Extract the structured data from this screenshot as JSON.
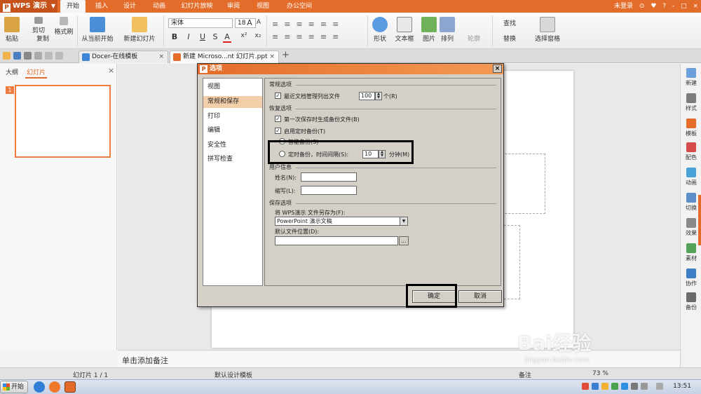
{
  "app": {
    "name": "WPS 演示",
    "logo_letter": "P",
    "menu_arrow": "▼",
    "tabs": [
      "开始",
      "插入",
      "设计",
      "动画",
      "幻灯片放映",
      "审阅",
      "视图",
      "办公空间"
    ],
    "login": "未登录",
    "title_icons": [
      "⊙",
      "♥",
      "?",
      "-",
      "□",
      "×"
    ]
  },
  "ribbon": {
    "paste": "粘贴",
    "cut": "剪切",
    "copy": "复制",
    "format_painter": "格式刷",
    "from_current": "从当前开始",
    "new_slide": "新建幻灯片",
    "font_name": "宋体",
    "font_size": "18",
    "grow_font": "A",
    "shrink_font": "A",
    "bold": "B",
    "italic": "I",
    "underline": "U",
    "strike": "S",
    "font_color": "A",
    "superscript": "x²",
    "subscript": "x₂",
    "shapes": "形状",
    "textbox": "文本框",
    "picture": "图片",
    "arrange": "排列",
    "outline": "轮廓",
    "find": "查找",
    "replace": "替换",
    "select_pane": "选择窗格"
  },
  "doctabs": {
    "tab1": "Docer-在线模板",
    "tab2": "新建 Microso...nt 幻灯片.ppt",
    "close": "×",
    "new_tab": "+"
  },
  "left_panel": {
    "tab_outline": "大纲",
    "tab_slides": "幻灯片",
    "close": "×",
    "slide_number": "1"
  },
  "notes": {
    "placeholder": "单击添加备注"
  },
  "right_bar": [
    "新建",
    "样式",
    "模板",
    "配色",
    "动画",
    "切换",
    "效果",
    "素材",
    "协作",
    "备份"
  ],
  "status": {
    "slide_info": "幻灯片 1 / 1",
    "template": "默认设计模板",
    "notes": "备注",
    "zoom": "73 %"
  },
  "taskbar": {
    "start": "开始",
    "clock": "13:51"
  },
  "dialog": {
    "title": "选项",
    "close": "×",
    "nav": [
      "视图",
      "常规和保存",
      "打印",
      "编辑",
      "安全性",
      "拼写检查"
    ],
    "general": {
      "section": "常规选项",
      "recent_files_label": "最近文档管理列出文件",
      "recent_files_value": "100",
      "recent_files_unit": "个(R)"
    },
    "recovery": {
      "section": "恢复选项",
      "backup_first_save": "第一次保存时生成备份文件(B)",
      "enable_timed_backup": "启用定时备份(T)",
      "smart_backup": "智能备份(S)",
      "timed_backup": "定时备份，时间间隔(S):",
      "interval_value": "10",
      "interval_unit": "分钟(M)"
    },
    "user": {
      "section": "用户信息",
      "name_label": "姓名(N):",
      "abbr_label": "缩写(L):"
    },
    "save": {
      "section": "保存选项",
      "save_as_label": "将 WPS演示 文件另存为(F):",
      "save_as_value": "PowerPoint 演示文稿",
      "default_path_label": "默认文件位置(D):",
      "browse": "..."
    },
    "ok": "确定",
    "cancel": "取消"
  },
  "watermark": {
    "brand": "Bai经验",
    "url": "jingyan.baidu.com"
  },
  "colors": {
    "accent": "#e46c2a",
    "nav_selected": "#f2cfa9",
    "dialog_bg": "#d4d0c8"
  }
}
